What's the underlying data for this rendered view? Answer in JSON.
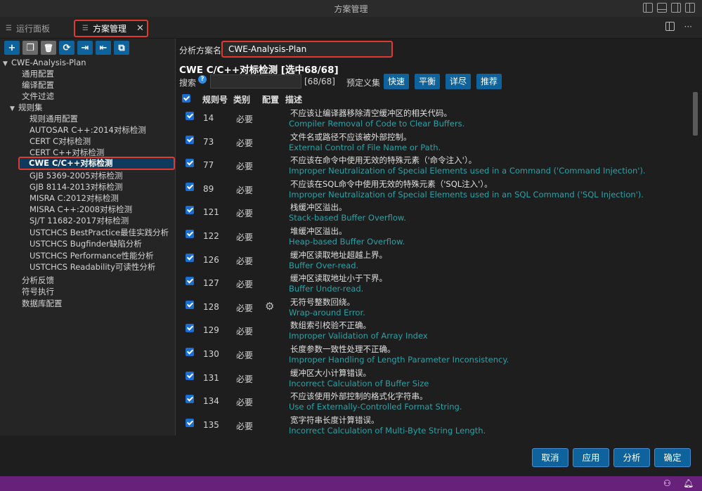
{
  "window": {
    "title": "方案管理"
  },
  "tabs": [
    {
      "label": "运行面板"
    },
    {
      "label": "方案管理",
      "close": "✕"
    }
  ],
  "toolbar": {
    "buttons": [
      {
        "icon": "plus-icon",
        "glyph": "+"
      },
      {
        "icon": "copy-icon",
        "glyph": "❐"
      },
      {
        "icon": "trash-icon",
        "glyph": "🗑"
      },
      {
        "icon": "refresh-icon",
        "glyph": "⟳"
      },
      {
        "icon": "import-icon",
        "glyph": "⇥"
      },
      {
        "icon": "export-icon",
        "glyph": "⇤"
      },
      {
        "icon": "duplicate-icon",
        "glyph": "⧉"
      }
    ]
  },
  "tree": {
    "root": "CWE-Analysis-Plan",
    "items": [
      "通用配置",
      "编译配置",
      "文件过滤"
    ],
    "ruleset": "规则集",
    "rules": [
      "规则通用配置",
      "AUTOSAR C++:2014对标检测",
      "CERT C对标检测",
      "CERT C++对标检测",
      "CWE C/C++对标检测",
      "GJB 5369-2005对标检测",
      "GJB 8114-2013对标检测",
      "MISRA C:2012对标检测",
      "MISRA C++:2008对标检测",
      "SJ/T 11682-2017对标检测",
      "USTCHCS BestPractice最佳实践分析",
      "USTCHCS Bugfinder缺陷分析",
      "USTCHCS Performance性能分析",
      "USTCHCS Readability可读性分析"
    ],
    "tail": [
      "分析反馈",
      "符号执行",
      "数据库配置"
    ]
  },
  "main": {
    "plan_name_label": "分析方案名",
    "plan_name_value": "CWE-Analysis-Plan",
    "title": "CWE C/C++对标检测 [选中68/68]",
    "search_label": "搜索",
    "search_count": "[68/68]",
    "preset_label": "预定义集",
    "presets": [
      "快速",
      "平衡",
      "详尽",
      "推荐"
    ],
    "headers": {
      "id": "规则号",
      "category": "类别",
      "config": "配置",
      "desc": "描述"
    },
    "rows": [
      {
        "id": "14",
        "cat": "必要",
        "cn": "不应该让编译器移除清空缓冲区的相关代码。",
        "en": "Compiler Removal of Code to Clear Buffers."
      },
      {
        "id": "73",
        "cat": "必要",
        "cn": "文件名或路径不应该被外部控制。",
        "en": "External Control of File Name or Path."
      },
      {
        "id": "77",
        "cat": "必要",
        "cn": "不应该在命令中使用无效的特殊元素（'命令注入'）。",
        "en": "Improper Neutralization of Special Elements used in a Command ('Command Injection')."
      },
      {
        "id": "89",
        "cat": "必要",
        "cn": "不应该在SQL命令中使用无效的特殊元素（'SQL注入'）。",
        "en": "Improper Neutralization of Special Elements used in an SQL Command ('SQL Injection')."
      },
      {
        "id": "121",
        "cat": "必要",
        "cn": "栈缓冲区溢出。",
        "en": "Stack-based Buffer Overflow."
      },
      {
        "id": "122",
        "cat": "必要",
        "cn": "堆缓冲区溢出。",
        "en": "Heap-based Buffer Overflow."
      },
      {
        "id": "126",
        "cat": "必要",
        "cn": "缓冲区读取地址超越上界。",
        "en": "Buffer Over-read."
      },
      {
        "id": "127",
        "cat": "必要",
        "cn": "缓冲区读取地址小于下界。",
        "en": "Buffer Under-read."
      },
      {
        "id": "128",
        "cat": "必要",
        "cn": "无符号整数回绕。",
        "en": "Wrap-around Error.",
        "gear": true
      },
      {
        "id": "129",
        "cat": "必要",
        "cn": "数组索引校验不正确。",
        "en": "Improper Validation of Array Index"
      },
      {
        "id": "130",
        "cat": "必要",
        "cn": "长度参数一致性处理不正确。",
        "en": "Improper Handling of Length Parameter Inconsistency."
      },
      {
        "id": "131",
        "cat": "必要",
        "cn": "缓冲区大小计算错误。",
        "en": "Incorrect Calculation of Buffer Size"
      },
      {
        "id": "134",
        "cat": "必要",
        "cn": "不应该使用外部控制的格式化字符串。",
        "en": "Use of Externally-Controlled Format String."
      },
      {
        "id": "135",
        "cat": "必要",
        "cn": "宽字符串长度计算错误。",
        "en": "Incorrect Calculation of Multi-Byte String Length."
      }
    ],
    "buttons": {
      "cancel": "取消",
      "apply": "应用",
      "analyze": "分析",
      "ok": "确定"
    }
  },
  "colors": {
    "accent": "#0e639c",
    "highlight": "#e03a2f",
    "statusbar": "#68217a",
    "desc_en": "#2aa3a8"
  }
}
